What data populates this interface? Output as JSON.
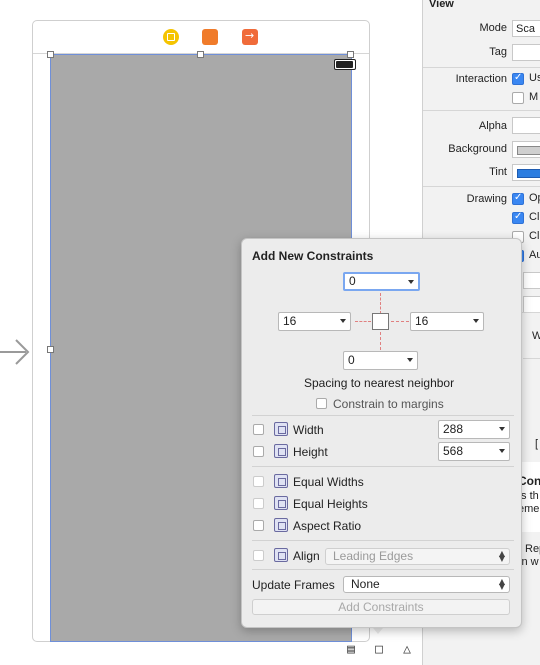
{
  "inspector": {
    "section_title": "View",
    "mode_label": "Mode",
    "mode_value": "Sca",
    "tag_label": "Tag",
    "tag_value": "",
    "interaction_label": "Interaction",
    "interaction_opt1": "Us",
    "interaction_opt2": "M",
    "alpha_label": "Alpha",
    "background_label": "Background",
    "tint_label": "Tint",
    "drawing_label": "Drawing",
    "drawing_opt1": "Op",
    "drawing_opt2": "Cl",
    "drawing_opt3": "Cl",
    "drawing_opt4": "Au",
    "w_text": "W",
    "bracket_text": "[",
    "section2_title": "Con",
    "section2_line1": "ts th",
    "section2_line2": "eme",
    "rep_line1": "Rep",
    "rep_line2": "in w"
  },
  "popover": {
    "title": "Add New Constraints",
    "top_value": "0",
    "left_value": "16",
    "right_value": "16",
    "bottom_value": "0",
    "spacing_caption": "Spacing to nearest neighbor",
    "constrain_margins": "Constrain to margins",
    "width_label": "Width",
    "width_value": "288",
    "height_label": "Height",
    "height_value": "568",
    "equal_widths": "Equal Widths",
    "equal_heights": "Equal Heights",
    "aspect_ratio": "Aspect Ratio",
    "align_label": "Align",
    "align_value": "Leading Edges",
    "update_frames_label": "Update Frames",
    "update_frames_value": "None",
    "add_button": "Add Constraints"
  },
  "toolbar": {
    "icons": [
      "align-icon",
      "pin-icon",
      "resolve-icon"
    ]
  },
  "colors": {
    "view_background": "#a9a9a9",
    "selection_border": "#6f8fd8",
    "checkbox_accent": "#3a87f2",
    "constraint_red": "#e08080"
  }
}
